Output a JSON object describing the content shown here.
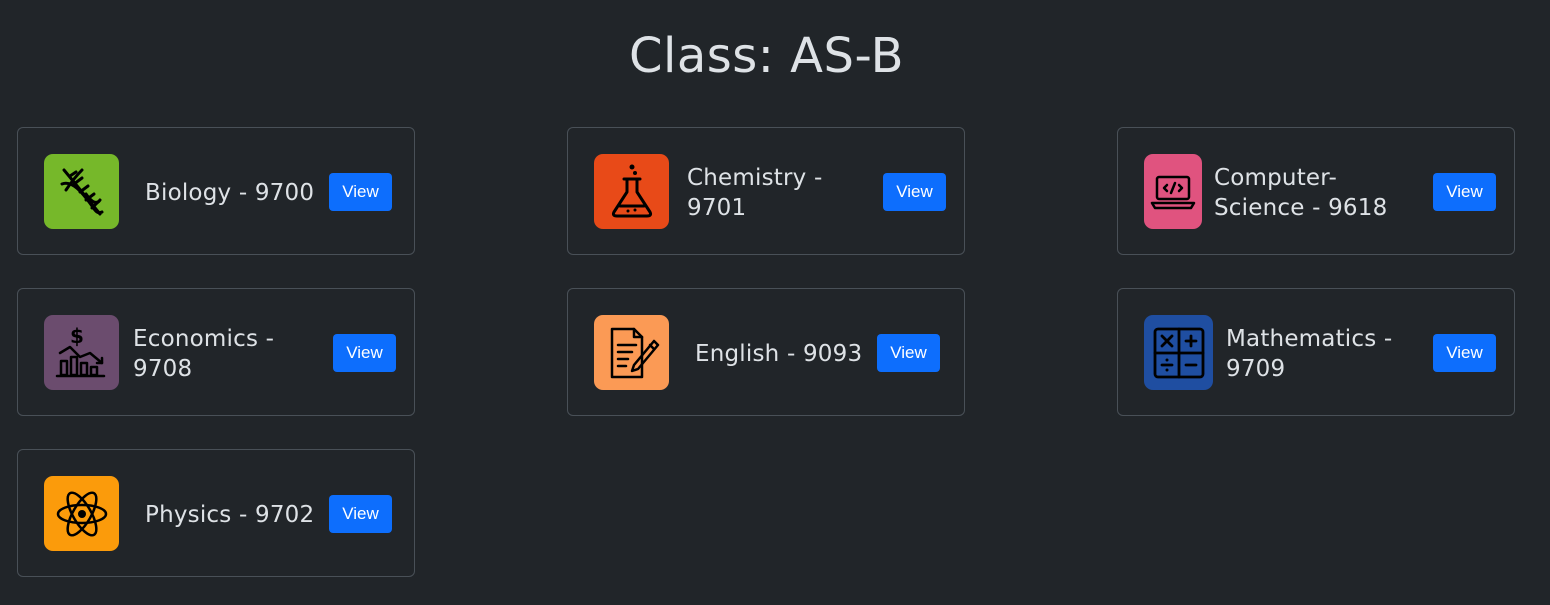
{
  "page": {
    "title": "Class: AS-B"
  },
  "subjects": [
    {
      "name": "Biology - 9700",
      "button": "View",
      "icon": "dna-icon",
      "color": "#76b82a"
    },
    {
      "name": "Chemistry - 9701",
      "button": "View",
      "icon": "flask-icon",
      "color": "#e84a18"
    },
    {
      "name": "Computer-Science - 9618",
      "button": "View",
      "icon": "laptop-code-icon",
      "color": "#e0537f"
    },
    {
      "name": "Economics - 9708",
      "button": "View",
      "icon": "economics-chart-icon",
      "color": "#6b4c6e"
    },
    {
      "name": "English - 9093",
      "button": "View",
      "icon": "document-pen-icon",
      "color": "#fb9a55"
    },
    {
      "name": "Mathematics - 9709",
      "button": "View",
      "icon": "calculator-icon",
      "color": "#1f4ea1"
    },
    {
      "name": "Physics - 9702",
      "button": "View",
      "icon": "atom-icon",
      "color": "#fb9b0b"
    }
  ],
  "colors": {
    "background": "#212529",
    "card_border": "#495057",
    "text": "#dee2e6",
    "button": "#0d6efd"
  }
}
